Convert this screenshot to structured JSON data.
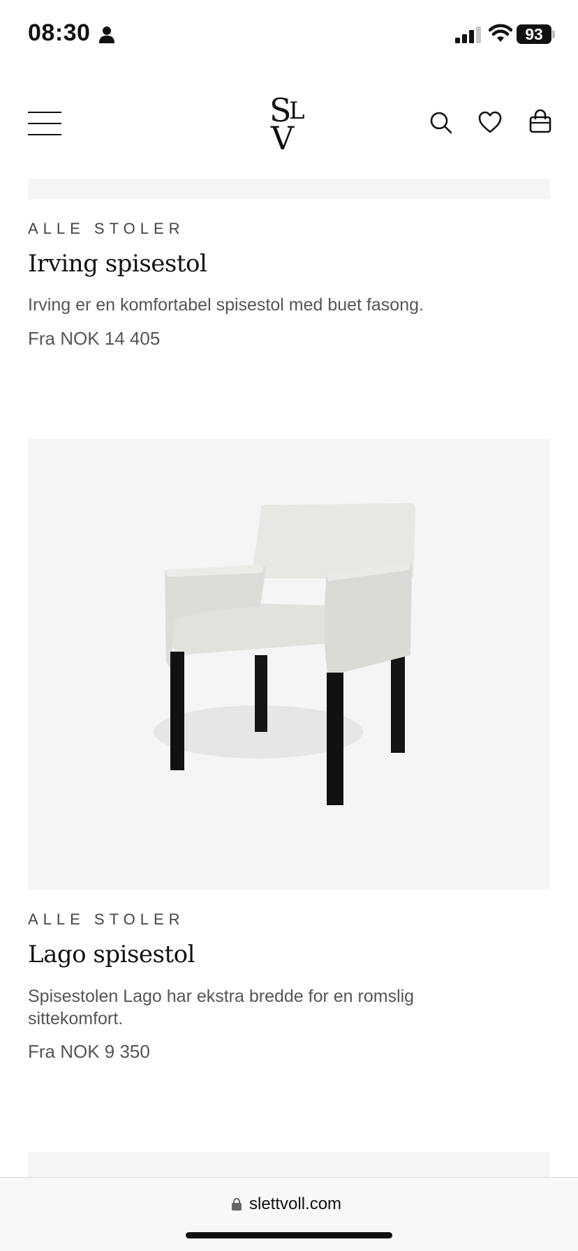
{
  "status_bar": {
    "time": "08:30",
    "battery": "93"
  },
  "header": {
    "logo_letters": [
      "S",
      "L",
      "V"
    ],
    "icons": [
      "menu-icon",
      "search-icon",
      "heart-icon",
      "bag-icon"
    ]
  },
  "products": [
    {
      "category": "ALLE STOLER",
      "name": "Irving spisestol",
      "description": "Irving er en komfortabel spisestol med buet fasong.",
      "price": "Fra NOK 14 405"
    },
    {
      "category": "ALLE STOLER",
      "name": "Lago spisestol",
      "description": "Spisestolen Lago har ekstra bredde for en romslig sittekomfort.",
      "price": "Fra NOK 9 350"
    }
  ],
  "browser": {
    "url": "slettvoll.com"
  }
}
